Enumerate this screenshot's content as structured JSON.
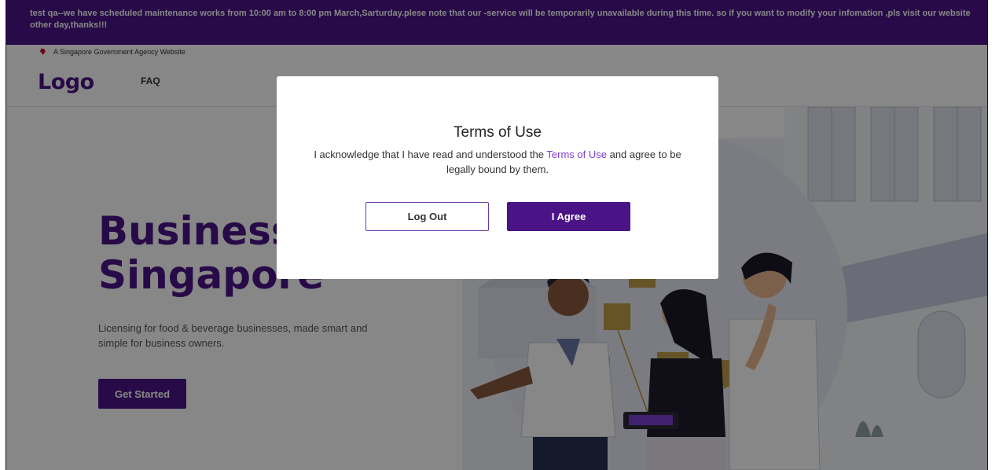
{
  "banner": {
    "message": "test qa--we have scheduled maintenance works from 10:00 am to 8:00 pm March,Sarturday.plese note that our -service will be temporarily unavailable during this time. so if you want to modify your infomation ,pls visit our website other day,thanks!!!"
  },
  "gov_strip": {
    "text": "A Singapore Government Agency Website",
    "icon": "lion-head-icon"
  },
  "header": {
    "logo": "Logo",
    "nav": [
      "FAQ"
    ]
  },
  "hero": {
    "title_line1": "Business",
    "title_line2": "Singapore",
    "subtitle": "Licensing for food & beverage businesses, made smart and simple for business owners.",
    "cta_label": "Get Started"
  },
  "modal": {
    "title": "Terms of Use",
    "body_before": "I acknowledge that I have read and understood the ",
    "body_link": "Terms of Use",
    "body_after": " and agree to be legally bound by them.",
    "logout_label": "Log Out",
    "agree_label": "I Agree"
  },
  "colors": {
    "brand": "#4a1486",
    "link": "#7b3fd1",
    "overlay": "rgba(0,0,0,0.47)"
  }
}
